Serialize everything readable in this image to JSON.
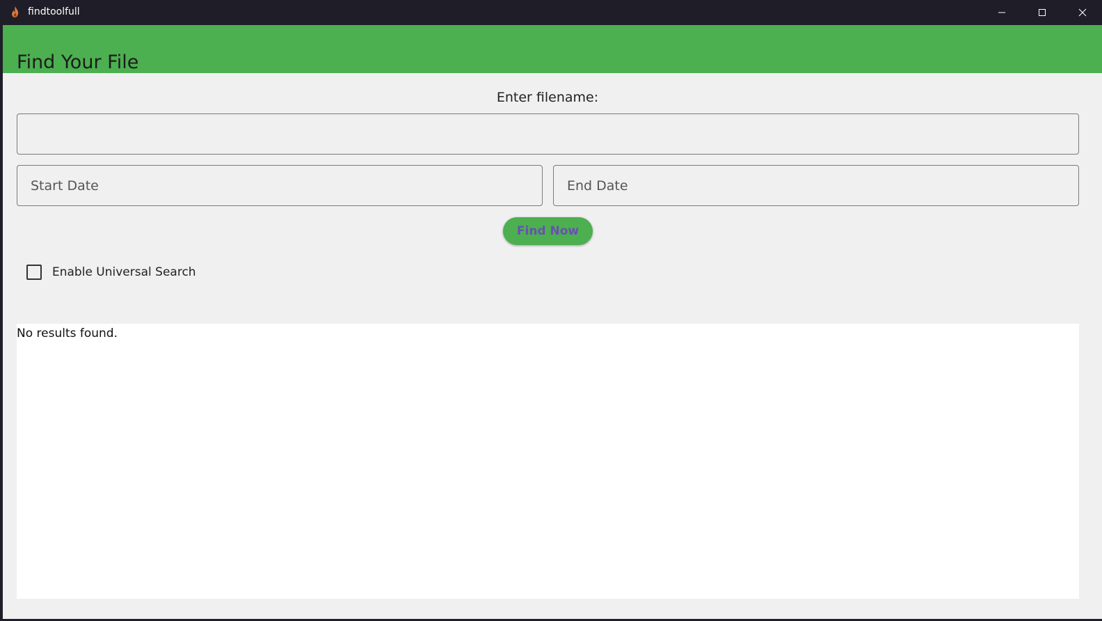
{
  "window": {
    "title": "findtoolfull",
    "icon": "flame-icon",
    "controls": {
      "minimize": "minimize-icon",
      "maximize": "maximize-icon",
      "close": "close-icon"
    }
  },
  "header": {
    "title": "Find Your File",
    "color": "#4caf50"
  },
  "form": {
    "filename_label": "Enter filename:",
    "filename_value": "",
    "start_date_placeholder": "Start Date",
    "end_date_placeholder": "End Date",
    "find_button_label": "Find Now",
    "find_button_text_color": "#6a4fb3",
    "universal_search_label": "Enable Universal Search",
    "universal_search_checked": false
  },
  "results": {
    "message": "No results found."
  }
}
